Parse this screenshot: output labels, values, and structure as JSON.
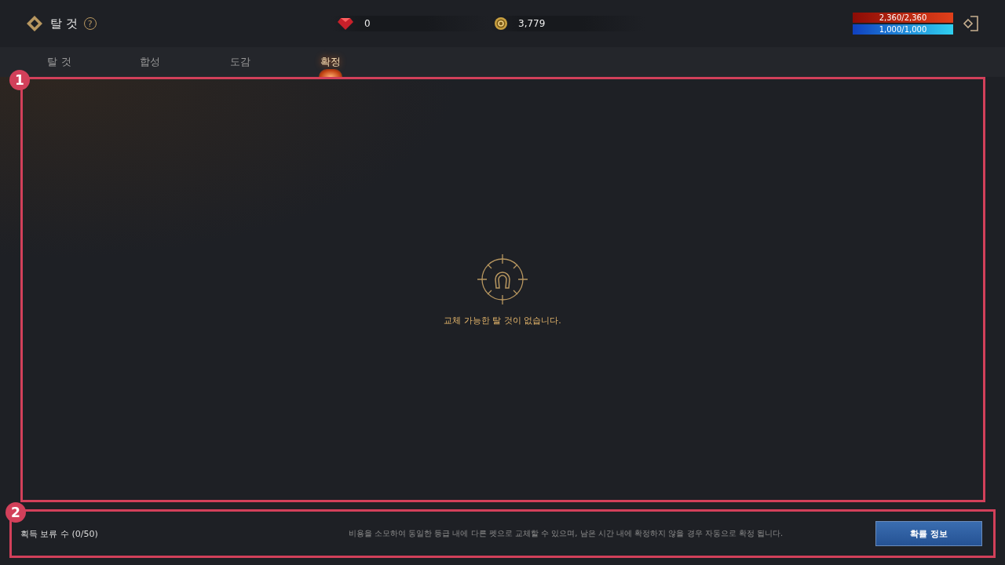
{
  "header": {
    "title": "탈 것",
    "help_icon": "?",
    "currencies": [
      {
        "kind": "gem",
        "amount": "0"
      },
      {
        "kind": "coin",
        "amount": "3,779"
      }
    ],
    "gauges": [
      {
        "kind": "hp",
        "reading": "2,360/2,360",
        "level": 1
      },
      {
        "kind": "mp",
        "reading": "1,000/1,000",
        "level": 1
      }
    ]
  },
  "tabs": [
    {
      "label": "탈 것",
      "selected": false
    },
    {
      "label": "합성",
      "selected": false
    },
    {
      "label": "도감",
      "selected": false
    },
    {
      "label": "확정",
      "selected": true
    }
  ],
  "main": {
    "callout": "1",
    "empty_message": "교체 가능한 탈 것이 없습니다."
  },
  "footer": {
    "callout": "2",
    "pending_count": "획득 보류 수 (0/50)",
    "notice": "비용을 소모하여 동일한 등급 내에 다른 펫으로 교체할 수 있으며, 남은 시간 내에 확정하지 않을 경우 자동으로 확정 됩니다.",
    "button": "확률 정보"
  }
}
